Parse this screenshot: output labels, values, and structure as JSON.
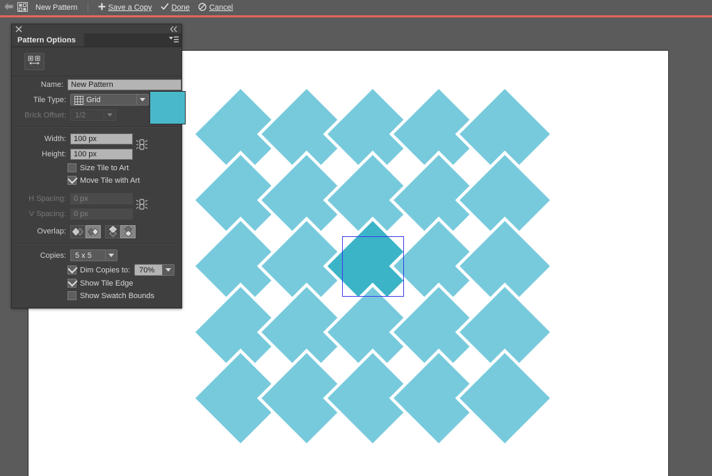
{
  "appbar": {
    "back_icon": "back-arrow-icon",
    "doc_icon": "pattern-doc-icon",
    "doc_title": "New Pattern",
    "save_copy_label": "Save a Copy",
    "done_label": "Done",
    "cancel_label": "Cancel",
    "plus_icon": "plus-icon",
    "check_icon": "check-icon",
    "ban_icon": "ban-icon"
  },
  "panel": {
    "close_icon": "close-icon",
    "collapse_icon": "double-chevron-left-icon",
    "menu_icon": "panel-menu-icon",
    "tab_title": "Pattern Options",
    "tile_tool_icon": "edit-pattern-tile-icon",
    "name": {
      "label": "Name:",
      "value": "New Pattern"
    },
    "tile_type": {
      "label": "Tile Type:",
      "value": "Grid",
      "icon": "grid-icon",
      "arrow_icon": "chevron-down-icon"
    },
    "brick_offset": {
      "label": "Brick Offset:",
      "value": "1/2",
      "disabled": true,
      "arrow_icon": "chevron-down-icon"
    },
    "width": {
      "label": "Width:",
      "value": "100 px"
    },
    "height": {
      "label": "Height:",
      "value": "100 px"
    },
    "size_link_icon": "constrain-proportions-link-icon",
    "size_tile_to_art": {
      "label": "Size Tile to Art",
      "checked": false
    },
    "move_tile_with_art": {
      "label": "Move Tile with Art",
      "checked": true
    },
    "h_spacing": {
      "label": "H Spacing:",
      "value": "0 px",
      "disabled": true
    },
    "v_spacing": {
      "label": "V Spacing:",
      "value": "0 px",
      "disabled": true
    },
    "spacing_link_icon": "constrain-proportions-link-icon",
    "overlap": {
      "label": "Overlap:",
      "buttons": [
        {
          "name": "overlap-left-in-front",
          "selected": false
        },
        {
          "name": "overlap-right-in-front",
          "selected": true
        },
        {
          "name": "overlap-top-in-front",
          "selected": false
        },
        {
          "name": "overlap-bottom-in-front",
          "selected": true
        }
      ]
    },
    "copies": {
      "label": "Copies:",
      "value": "5 x 5",
      "arrow_icon": "chevron-down-icon"
    },
    "dim_copies": {
      "label": "Dim Copies to:",
      "checked": true,
      "value": "70%",
      "arrow_icon": "chevron-down-icon"
    },
    "show_tile_edge": {
      "label": "Show Tile Edge",
      "checked": true
    },
    "show_swatch_bounds": {
      "label": "Show Swatch Bounds",
      "checked": false
    }
  },
  "artwork": {
    "shape": "diamond",
    "tile_color_full": "#3cb4c8",
    "tile_color_dimmed": "#77cadc",
    "tile_edge_color": "#3a3ae8",
    "artboard_color": "#ffffff",
    "grid_cols": 5,
    "grid_rows": 5,
    "diamond_size_px": 130,
    "spacing_px": 95,
    "center_index": {
      "row": 2,
      "col": 2
    }
  }
}
